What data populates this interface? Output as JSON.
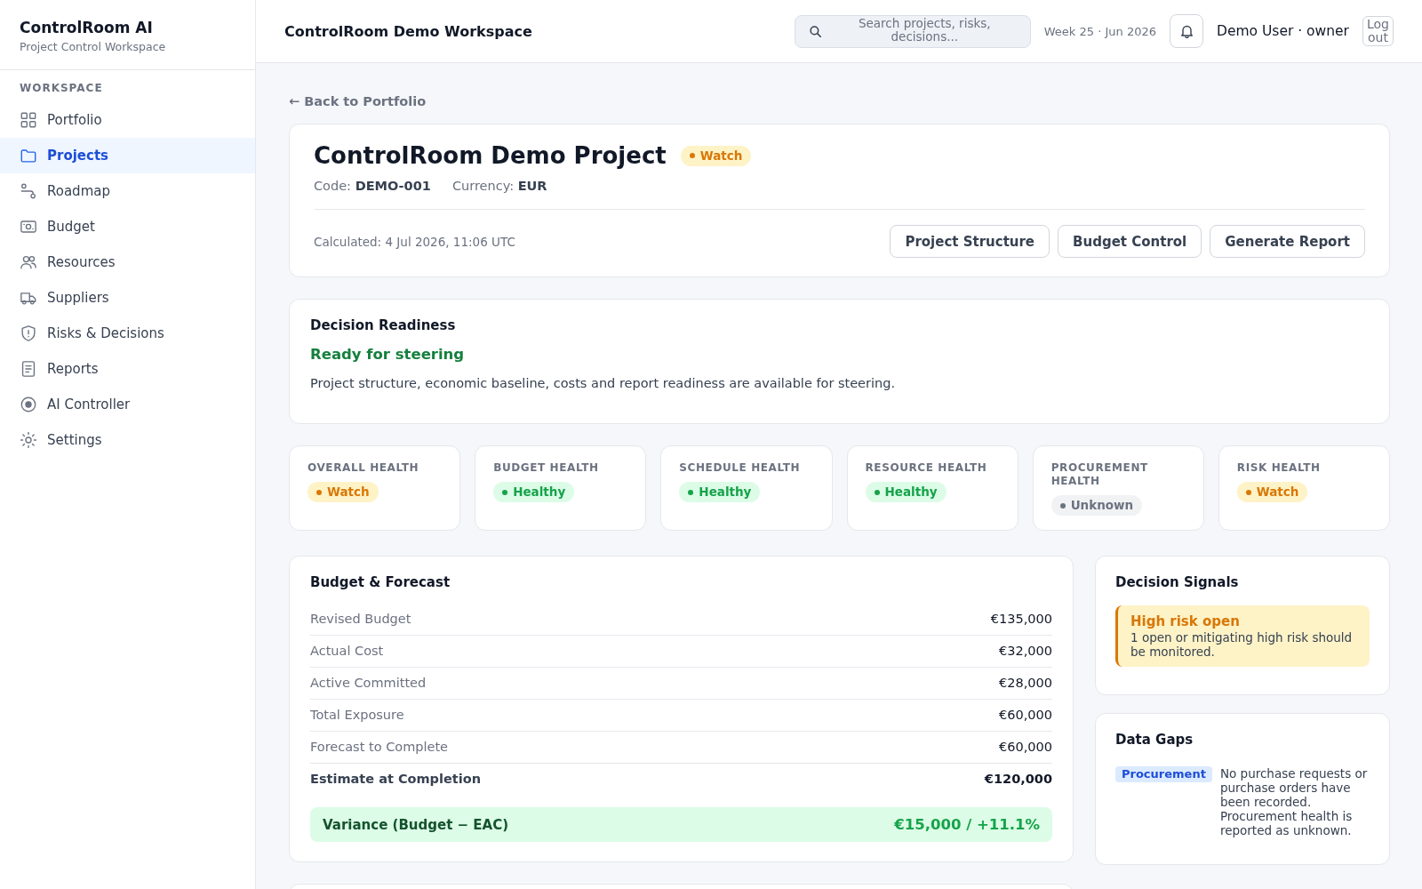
{
  "sidebar": {
    "brand": {
      "title": "ControlRoom AI",
      "subtitle": "Project Control Workspace"
    },
    "section_label": "WORKSPACE",
    "items": [
      {
        "label": "Portfolio",
        "selected": false
      },
      {
        "label": "Projects",
        "selected": true
      },
      {
        "label": "Roadmap",
        "selected": false
      },
      {
        "label": "Budget",
        "selected": false
      },
      {
        "label": "Resources",
        "selected": false
      },
      {
        "label": "Suppliers",
        "selected": false
      },
      {
        "label": "Risks & Decisions",
        "selected": false
      },
      {
        "label": "Reports",
        "selected": false
      },
      {
        "label": "AI Controller",
        "selected": false
      },
      {
        "label": "Settings",
        "selected": false
      }
    ]
  },
  "header": {
    "title": "ControlRoom Demo Workspace",
    "search": {
      "placeholder": "Search projects, risks, decisions..."
    },
    "week": "Week 25 · Jun 2026",
    "user": "Demo User · owner",
    "logout_button": "Log out"
  },
  "back_link": "← Back to Portfolio",
  "project": {
    "title": "ControlRoom Demo Project",
    "status": {
      "label": "Watch",
      "kind": "watch"
    },
    "code": "Code: **DEMO-001**",
    "currency": "Currency: **EUR**",
    "calculated": "Calculated: 4 Jul 2026, 11:06 UTC",
    "buttons": [
      "Project Structure",
      "Budget Control",
      "Generate Report"
    ]
  },
  "decision_readiness": {
    "title": "Decision Readiness",
    "status": "Ready for steering",
    "description": "Project structure, economic baseline, costs and report readiness are available for steering."
  },
  "health": [
    {
      "label": "OVERALL HEALTH",
      "status": "Watch",
      "kind": "watch"
    },
    {
      "label": "BUDGET HEALTH",
      "status": "Healthy",
      "kind": "healthy"
    },
    {
      "label": "SCHEDULE HEALTH",
      "status": "Healthy",
      "kind": "healthy"
    },
    {
      "label": "RESOURCE HEALTH",
      "status": "Healthy",
      "kind": "healthy"
    },
    {
      "label": "PROCUREMENT HEALTH",
      "status": "Unknown",
      "kind": "unknown"
    },
    {
      "label": "RISK HEALTH",
      "status": "Watch",
      "kind": "watch"
    }
  ],
  "budget": {
    "title": "Budget & Forecast",
    "rows": [
      {
        "label": "Revised Budget",
        "value": "€135,000",
        "kind": "line"
      },
      {
        "label": "Actual Cost",
        "value": "€32,000",
        "kind": "line"
      },
      {
        "label": "Active Committed",
        "value": "€28,000",
        "kind": "line"
      },
      {
        "label": "Total Exposure",
        "value": "€60,000",
        "kind": "line"
      },
      {
        "label": "Forecast to Complete",
        "value": "€60,000",
        "kind": "line"
      },
      {
        "label": "Estimate at Completion",
        "value": "€120,000",
        "kind": "total"
      }
    ],
    "variance": {
      "label": "Variance (Budget − EAC)",
      "value": "€15,000 / +11.1%"
    }
  },
  "decision_signals": {
    "title": "Decision Signals",
    "signals": [
      {
        "title": "High risk open",
        "text": "1 open or mitigating high risk should be monitored.",
        "kind": "warning"
      }
    ]
  },
  "data_gaps": {
    "title": "Data Gaps",
    "items": [
      {
        "tag": "Procurement",
        "text": "No purchase requests or purchase orders have been recorded. Procurement health is reported as unknown."
      }
    ]
  }
}
